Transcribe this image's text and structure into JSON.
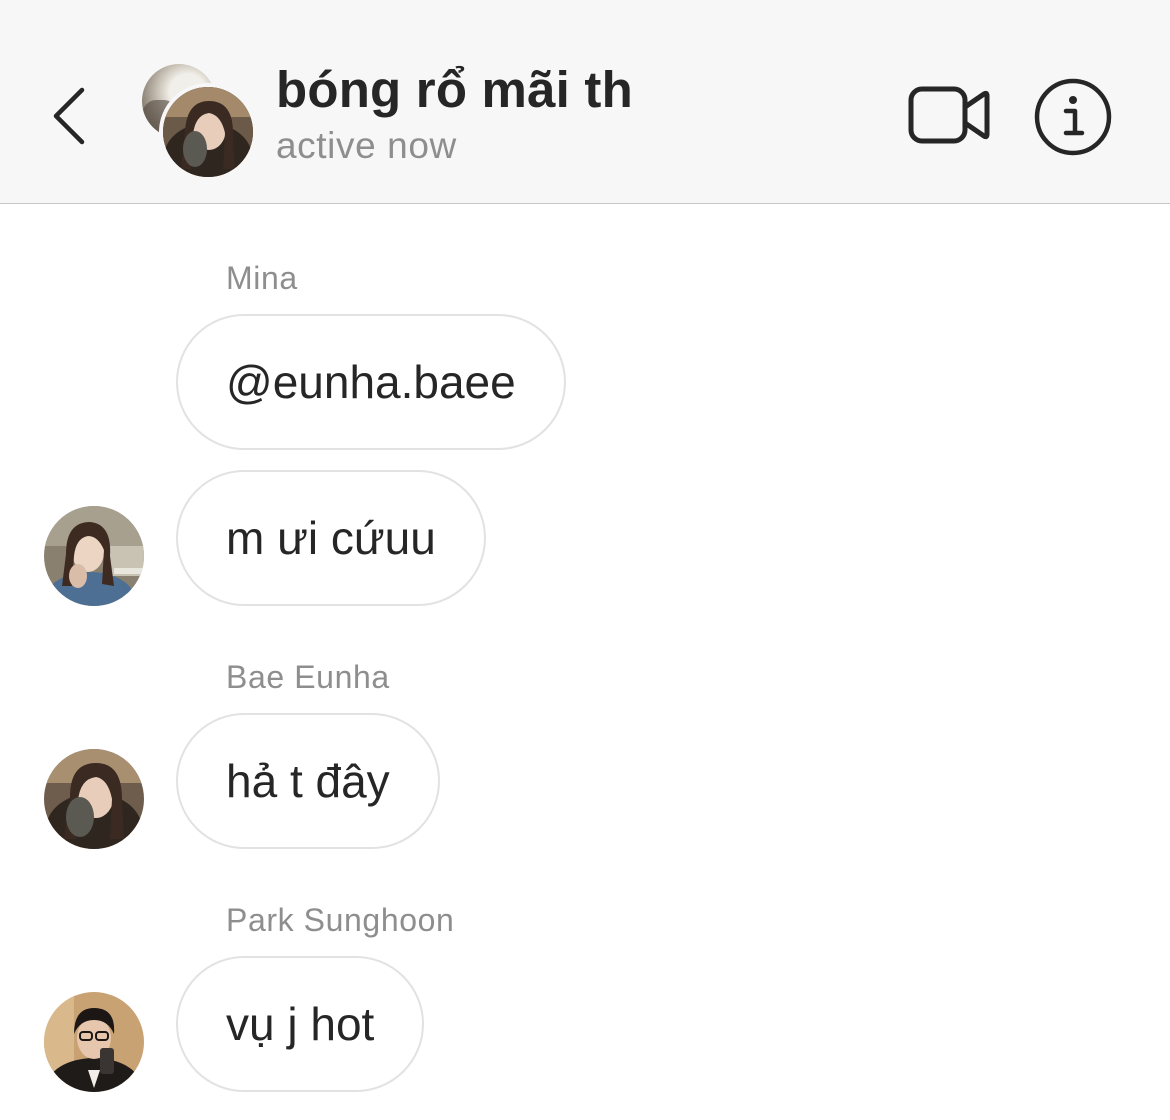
{
  "header": {
    "title": "bóng rổ mãi th",
    "status": "active now",
    "back_icon": "chevron-left-icon",
    "video_icon": "video-camera-icon",
    "info_icon": "info-icon"
  },
  "messages": [
    {
      "sender": "Mina",
      "text": "@eunha.baee"
    },
    {
      "sender": "",
      "text": "m ưi cứuu"
    },
    {
      "sender": "Bae Eunha",
      "text": "hả t đây"
    },
    {
      "sender": "Park Sunghoon",
      "text": "vụ j hot"
    }
  ],
  "colors": {
    "header_bg": "#f7f7f7",
    "divider": "#c7c7c7",
    "text_primary": "#262626",
    "text_secondary": "#8e8e8e",
    "bubble_border": "#e2e2e2"
  }
}
